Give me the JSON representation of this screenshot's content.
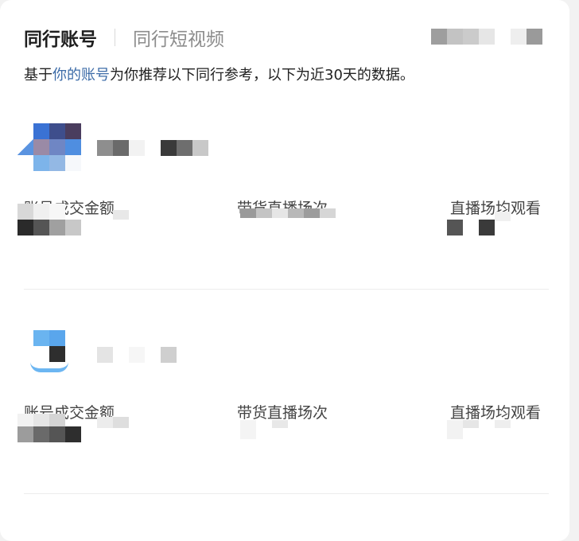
{
  "tabs": {
    "active_label": "同行账号",
    "inactive_label": "同行短视频"
  },
  "subtitle": {
    "prefix": "基于",
    "link": "你的账号",
    "suffix": "为你推荐以下同行参考，以下为近30天的数据。"
  },
  "accounts": [
    {
      "metrics": [
        {
          "label": "账号成交金额"
        },
        {
          "label": "带货直播场次"
        },
        {
          "label": "直播场均观看"
        }
      ]
    },
    {
      "metrics": [
        {
          "label": "账号成交金额"
        },
        {
          "label": "带货直播场次"
        },
        {
          "label": "直播场均观看"
        }
      ]
    }
  ],
  "colors": {
    "link": "#3d6ca8",
    "active_tab": "#1e1e1e",
    "inactive_tab": "#8c8c8c",
    "divider": "#ececec"
  }
}
